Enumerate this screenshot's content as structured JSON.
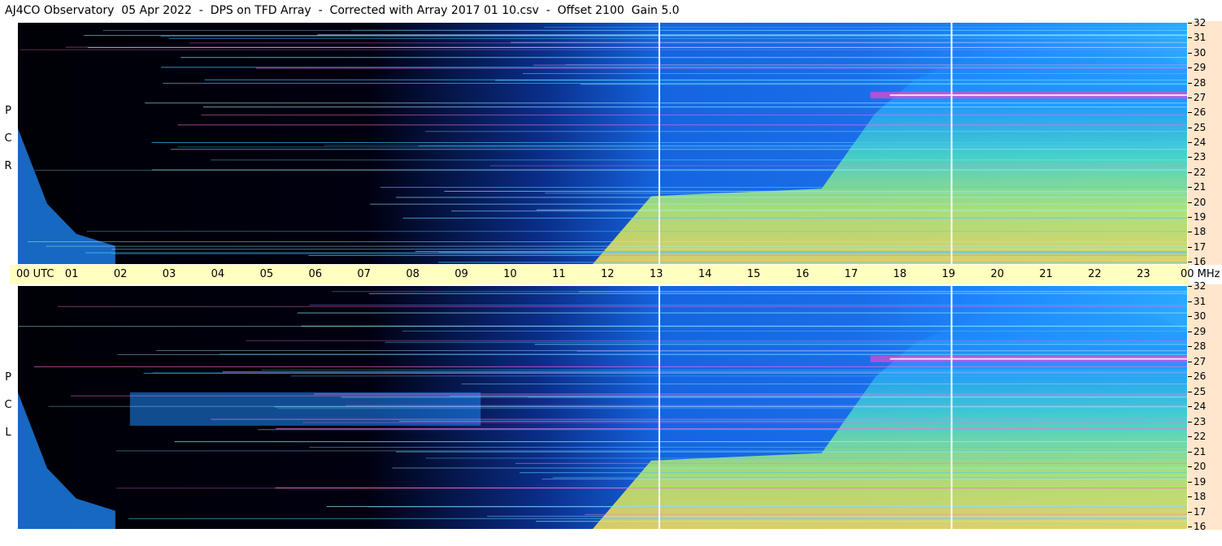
{
  "title": "AJ4CO Observatory  05 Apr 2022  -  DPS on TFD Array  -  Corrected with Array 2017 01 10.csv  -  Offset 2100  Gain 5.0",
  "panels": {
    "top": {
      "label": [
        "R",
        "C",
        "P"
      ]
    },
    "bottom": {
      "label": [
        "L",
        "C",
        "P"
      ]
    }
  },
  "colors": {
    "background": "#000000",
    "low": "#0a1a6e",
    "mid": "#1f8bff",
    "high": "#49e0c8",
    "higher": "#e8f040",
    "peak": "#ff40d0",
    "axis_bar": "#ffffc0",
    "freq_bar": "#ffe6cc",
    "marker_line": "#ffffff"
  },
  "chart_data": {
    "type": "heatmap",
    "title": "AJ4CO Observatory  05 Apr 2022  -  DPS on TFD Array  -  Corrected with Array 2017 01 10.csv  -  Offset 2100  Gain 5.0",
    "x_tick_labels": [
      "00 UTC",
      "01",
      "02",
      "03",
      "04",
      "05",
      "06",
      "07",
      "08",
      "09",
      "10",
      "11",
      "12",
      "13",
      "14",
      "15",
      "16",
      "17",
      "18",
      "19",
      "20",
      "21",
      "22",
      "23",
      "00 MHz"
    ],
    "x_range_hours": [
      0,
      24
    ],
    "y_unit": "MHz",
    "y_tick_labels": [
      "32",
      "31",
      "30",
      "29",
      "28",
      "27",
      "26",
      "25",
      "24",
      "23",
      "22",
      "21",
      "20",
      "19",
      "18",
      "17",
      "16"
    ],
    "y_range_mhz": [
      16,
      32
    ],
    "panels": [
      "R C P",
      "L C P"
    ],
    "marker_lines_hours": [
      13.15,
      19.15
    ],
    "strong_band_mhz": 27.2
  }
}
